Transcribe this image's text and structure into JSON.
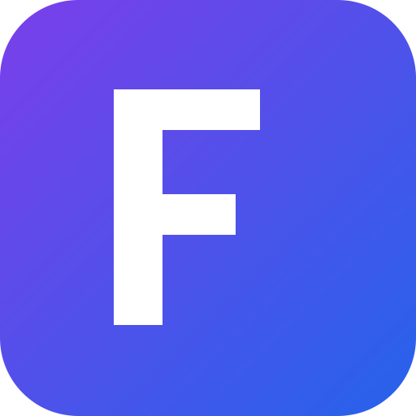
{
  "icon": {
    "letter": "F",
    "gradient_start": "#7B3FEA",
    "gradient_end": "#2563EB",
    "glyph_color": "#FFFFFF"
  }
}
